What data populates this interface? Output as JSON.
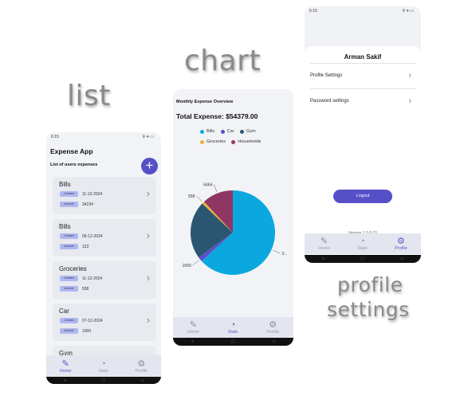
{
  "labels": {
    "list": "list",
    "chart": "chart",
    "profile_line1": "profile",
    "profile_line2": "settings"
  },
  "status_time": "6:15",
  "status_icons": "⚲✈▭",
  "nav": {
    "home": "Home",
    "stats": "Stats",
    "profile": "Profile"
  },
  "sysbar": {
    "menu": "≡",
    "home": "▢",
    "back": "◁"
  },
  "list_screen": {
    "title": "Expense App",
    "subtitle": "List of users expenses",
    "add_icon": "+",
    "cards": [
      {
        "title": "Bills",
        "date_label": "Created",
        "date": "11-12-2024",
        "amount_label": "Amount",
        "amount": "34234"
      },
      {
        "title": "Bills",
        "date_label": "Created",
        "date": "05-12-2024",
        "amount_label": "Amount",
        "amount": "123"
      },
      {
        "title": "Groceries",
        "date_label": "Created",
        "date": "11-12-2024",
        "amount_label": "Amount",
        "amount": "558"
      },
      {
        "title": "Car",
        "date_label": "Created",
        "date": "07-12-2024",
        "amount_label": "Amount",
        "amount": "1000"
      },
      {
        "title": "Gym"
      }
    ]
  },
  "chart_screen": {
    "title": "Monthly Expense Overview",
    "total": "Total Expense: $54379.00"
  },
  "chart_data": {
    "type": "pie",
    "title": "Monthly Expense Overview",
    "series": [
      {
        "name": "Bills",
        "value": 34357,
        "label": "3...",
        "color": "#0aa8df"
      },
      {
        "name": "Car",
        "value": 1000,
        "label": "1000",
        "color": "#5b4fc8"
      },
      {
        "name": "Gym",
        "value": 12000,
        "label": "",
        "color": "#2a5672"
      },
      {
        "name": "Groceries",
        "value": 558,
        "label": "558",
        "color": "#e7b23a"
      },
      {
        "name": "Households",
        "value": 6464,
        "label": "6464",
        "color": "#8f3663"
      }
    ],
    "legend_placement": "top"
  },
  "profile_screen": {
    "name": "Arman Sakif",
    "items": [
      "Profile Settings",
      "Password settings"
    ],
    "logout": "Logout",
    "version": "Version 1.0.0 (1)"
  }
}
